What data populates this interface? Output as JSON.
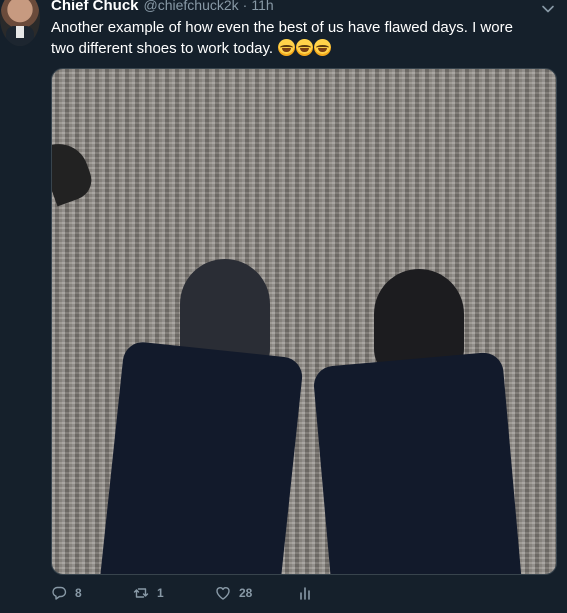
{
  "tweet": {
    "author_name": "Chief Chuck",
    "handle": "@chiefchuck2k",
    "separator": "·",
    "time": "11h",
    "text": "Another example of how even the best of us have flawed days. I wore two different shoes to work today.",
    "emojis": [
      "face-with-tears-of-joy",
      "face-with-tears-of-joy",
      "face-with-tears-of-joy"
    ]
  },
  "actions": {
    "reply_count": "8",
    "retweet_count": "1",
    "like_count": "28"
  },
  "icons": {
    "reply": "reply-icon",
    "retweet": "retweet-icon",
    "like": "heart-icon",
    "analytics": "analytics-icon",
    "caret": "chevron-down-icon"
  },
  "colors": {
    "background": "#15202b",
    "secondary_text": "#8899a6"
  }
}
